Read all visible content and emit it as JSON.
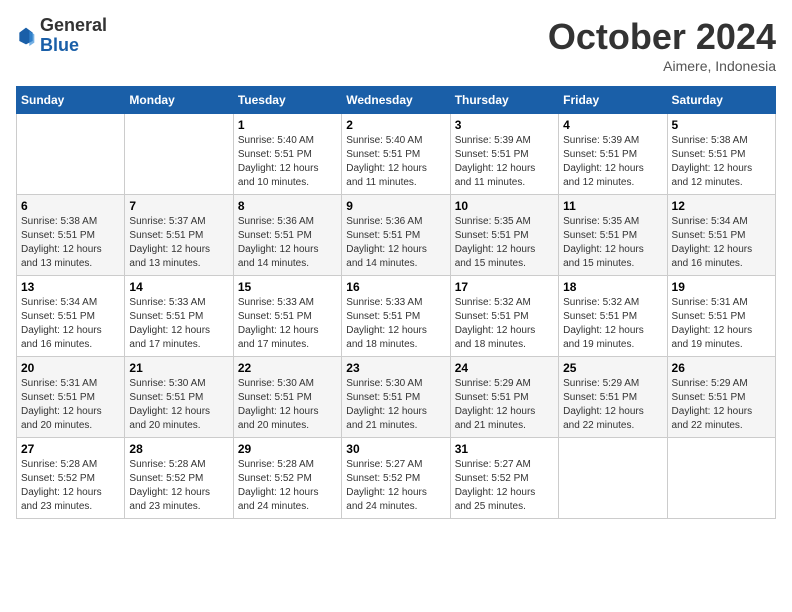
{
  "header": {
    "logo_general": "General",
    "logo_blue": "Blue",
    "month_title": "October 2024",
    "location": "Aimere, Indonesia"
  },
  "days_of_week": [
    "Sunday",
    "Monday",
    "Tuesday",
    "Wednesday",
    "Thursday",
    "Friday",
    "Saturday"
  ],
  "weeks": [
    [
      {
        "day": "",
        "info": ""
      },
      {
        "day": "",
        "info": ""
      },
      {
        "day": "1",
        "info": "Sunrise: 5:40 AM\nSunset: 5:51 PM\nDaylight: 12 hours and 10 minutes."
      },
      {
        "day": "2",
        "info": "Sunrise: 5:40 AM\nSunset: 5:51 PM\nDaylight: 12 hours and 11 minutes."
      },
      {
        "day": "3",
        "info": "Sunrise: 5:39 AM\nSunset: 5:51 PM\nDaylight: 12 hours and 11 minutes."
      },
      {
        "day": "4",
        "info": "Sunrise: 5:39 AM\nSunset: 5:51 PM\nDaylight: 12 hours and 12 minutes."
      },
      {
        "day": "5",
        "info": "Sunrise: 5:38 AM\nSunset: 5:51 PM\nDaylight: 12 hours and 12 minutes."
      }
    ],
    [
      {
        "day": "6",
        "info": "Sunrise: 5:38 AM\nSunset: 5:51 PM\nDaylight: 12 hours and 13 minutes."
      },
      {
        "day": "7",
        "info": "Sunrise: 5:37 AM\nSunset: 5:51 PM\nDaylight: 12 hours and 13 minutes."
      },
      {
        "day": "8",
        "info": "Sunrise: 5:36 AM\nSunset: 5:51 PM\nDaylight: 12 hours and 14 minutes."
      },
      {
        "day": "9",
        "info": "Sunrise: 5:36 AM\nSunset: 5:51 PM\nDaylight: 12 hours and 14 minutes."
      },
      {
        "day": "10",
        "info": "Sunrise: 5:35 AM\nSunset: 5:51 PM\nDaylight: 12 hours and 15 minutes."
      },
      {
        "day": "11",
        "info": "Sunrise: 5:35 AM\nSunset: 5:51 PM\nDaylight: 12 hours and 15 minutes."
      },
      {
        "day": "12",
        "info": "Sunrise: 5:34 AM\nSunset: 5:51 PM\nDaylight: 12 hours and 16 minutes."
      }
    ],
    [
      {
        "day": "13",
        "info": "Sunrise: 5:34 AM\nSunset: 5:51 PM\nDaylight: 12 hours and 16 minutes."
      },
      {
        "day": "14",
        "info": "Sunrise: 5:33 AM\nSunset: 5:51 PM\nDaylight: 12 hours and 17 minutes."
      },
      {
        "day": "15",
        "info": "Sunrise: 5:33 AM\nSunset: 5:51 PM\nDaylight: 12 hours and 17 minutes."
      },
      {
        "day": "16",
        "info": "Sunrise: 5:33 AM\nSunset: 5:51 PM\nDaylight: 12 hours and 18 minutes."
      },
      {
        "day": "17",
        "info": "Sunrise: 5:32 AM\nSunset: 5:51 PM\nDaylight: 12 hours and 18 minutes."
      },
      {
        "day": "18",
        "info": "Sunrise: 5:32 AM\nSunset: 5:51 PM\nDaylight: 12 hours and 19 minutes."
      },
      {
        "day": "19",
        "info": "Sunrise: 5:31 AM\nSunset: 5:51 PM\nDaylight: 12 hours and 19 minutes."
      }
    ],
    [
      {
        "day": "20",
        "info": "Sunrise: 5:31 AM\nSunset: 5:51 PM\nDaylight: 12 hours and 20 minutes."
      },
      {
        "day": "21",
        "info": "Sunrise: 5:30 AM\nSunset: 5:51 PM\nDaylight: 12 hours and 20 minutes."
      },
      {
        "day": "22",
        "info": "Sunrise: 5:30 AM\nSunset: 5:51 PM\nDaylight: 12 hours and 20 minutes."
      },
      {
        "day": "23",
        "info": "Sunrise: 5:30 AM\nSunset: 5:51 PM\nDaylight: 12 hours and 21 minutes."
      },
      {
        "day": "24",
        "info": "Sunrise: 5:29 AM\nSunset: 5:51 PM\nDaylight: 12 hours and 21 minutes."
      },
      {
        "day": "25",
        "info": "Sunrise: 5:29 AM\nSunset: 5:51 PM\nDaylight: 12 hours and 22 minutes."
      },
      {
        "day": "26",
        "info": "Sunrise: 5:29 AM\nSunset: 5:51 PM\nDaylight: 12 hours and 22 minutes."
      }
    ],
    [
      {
        "day": "27",
        "info": "Sunrise: 5:28 AM\nSunset: 5:52 PM\nDaylight: 12 hours and 23 minutes."
      },
      {
        "day": "28",
        "info": "Sunrise: 5:28 AM\nSunset: 5:52 PM\nDaylight: 12 hours and 23 minutes."
      },
      {
        "day": "29",
        "info": "Sunrise: 5:28 AM\nSunset: 5:52 PM\nDaylight: 12 hours and 24 minutes."
      },
      {
        "day": "30",
        "info": "Sunrise: 5:27 AM\nSunset: 5:52 PM\nDaylight: 12 hours and 24 minutes."
      },
      {
        "day": "31",
        "info": "Sunrise: 5:27 AM\nSunset: 5:52 PM\nDaylight: 12 hours and 25 minutes."
      },
      {
        "day": "",
        "info": ""
      },
      {
        "day": "",
        "info": ""
      }
    ]
  ]
}
